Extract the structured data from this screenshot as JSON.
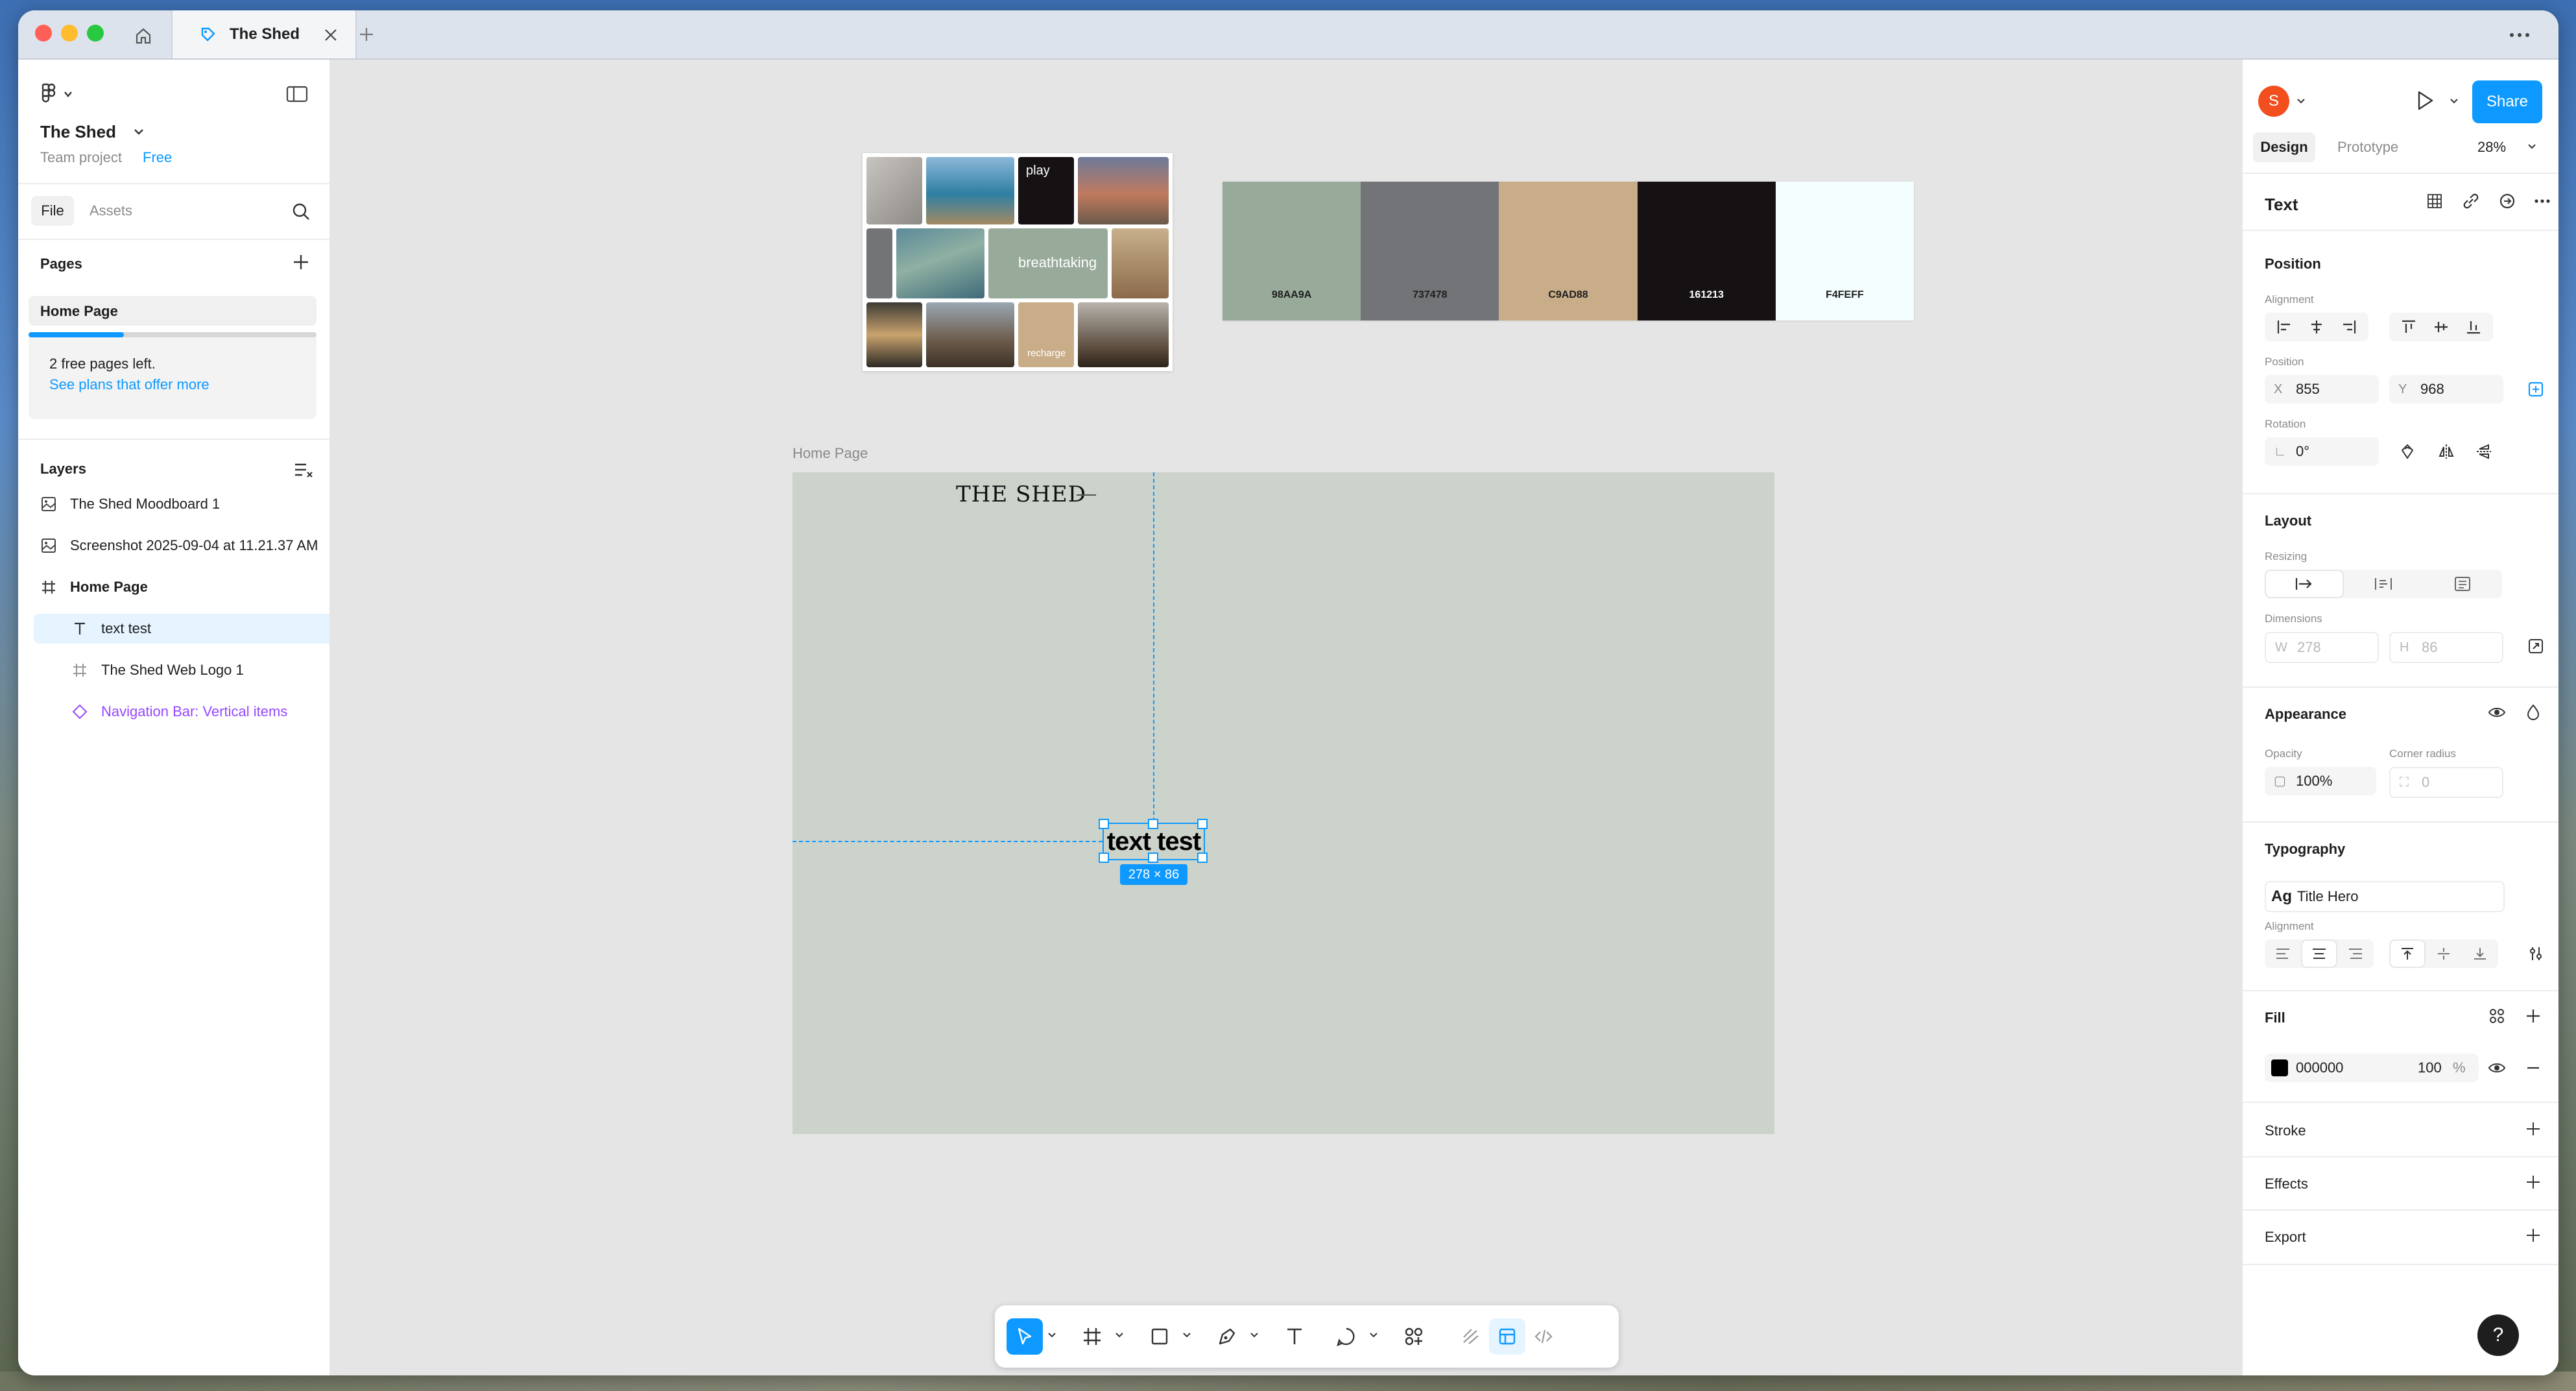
{
  "window": {
    "tab_title": "The Shed"
  },
  "left_panel": {
    "file_name": "The Shed",
    "team": "Team project",
    "plan": "Free",
    "tabs": {
      "file": "File",
      "assets": "Assets"
    },
    "pages_heading": "Pages",
    "current_page": "Home Page",
    "free_pages_text": "2 free pages left.",
    "plans_link": "See plans that offer more",
    "free_pages_progress": 0.33,
    "layers_heading": "Layers",
    "layers": [
      {
        "label": "The Shed Moodboard 1",
        "icon": "image-icon"
      },
      {
        "label": "Screenshot 2025-09-04 at 11.21.37 AM",
        "icon": "image-icon"
      },
      {
        "label": "Home Page",
        "icon": "frame-icon"
      },
      {
        "label": "text test",
        "icon": "text-icon"
      },
      {
        "label": "The Shed Web Logo 1",
        "icon": "frame-icon"
      },
      {
        "label": "Navigation Bar: Vertical items",
        "icon": "component-instance-icon"
      }
    ]
  },
  "canvas": {
    "moodboard_labels": {
      "play": "play",
      "breathtaking": "breathtaking",
      "recharge": "recharge"
    },
    "palette": [
      {
        "hex": "98AA9A",
        "color": "#98aa9a"
      },
      {
        "hex": "737478",
        "color": "#737478"
      },
      {
        "hex": "C9AD88",
        "color": "#c9ad88"
      },
      {
        "hex": "161213",
        "color": "#161213"
      },
      {
        "hex": "F4FEFF",
        "color": "#f4feff"
      }
    ],
    "frame_label": "Home Page",
    "site_logo": "THE SHED",
    "selected_text": "text test",
    "dimension_badge": "278 × 86"
  },
  "right_panel": {
    "avatar_initial": "S",
    "share": "Share",
    "tabs": {
      "design": "Design",
      "prototype": "Prototype"
    },
    "zoom": "28%",
    "layer_type": "Text",
    "position": {
      "title": "Position",
      "alignment_label": "Alignment",
      "position_label": "Position",
      "x_prefix": "X",
      "x": "855",
      "y_prefix": "Y",
      "y": "968",
      "rotation_label": "Rotation",
      "rotation": "0°"
    },
    "layout": {
      "title": "Layout",
      "resizing_label": "Resizing",
      "dimensions_label": "Dimensions",
      "w_prefix": "W",
      "w": "278",
      "h_prefix": "H",
      "h": "86"
    },
    "appearance": {
      "title": "Appearance",
      "opacity_label": "Opacity",
      "opacity": "100%",
      "radius_label": "Corner radius",
      "radius": "0"
    },
    "typography": {
      "title": "Typography",
      "style_prefix": "Ag",
      "style": "Title Hero",
      "alignment_label": "Alignment"
    },
    "fill": {
      "title": "Fill",
      "hex": "000000",
      "opacity": "100",
      "percent": "%"
    },
    "stroke": "Stroke",
    "effects": "Effects",
    "export": "Export",
    "help": "?"
  },
  "colors": {
    "accent": "#0d99ff",
    "frame_bg": "#ccd3cb",
    "avatar": "#f24e1e"
  }
}
